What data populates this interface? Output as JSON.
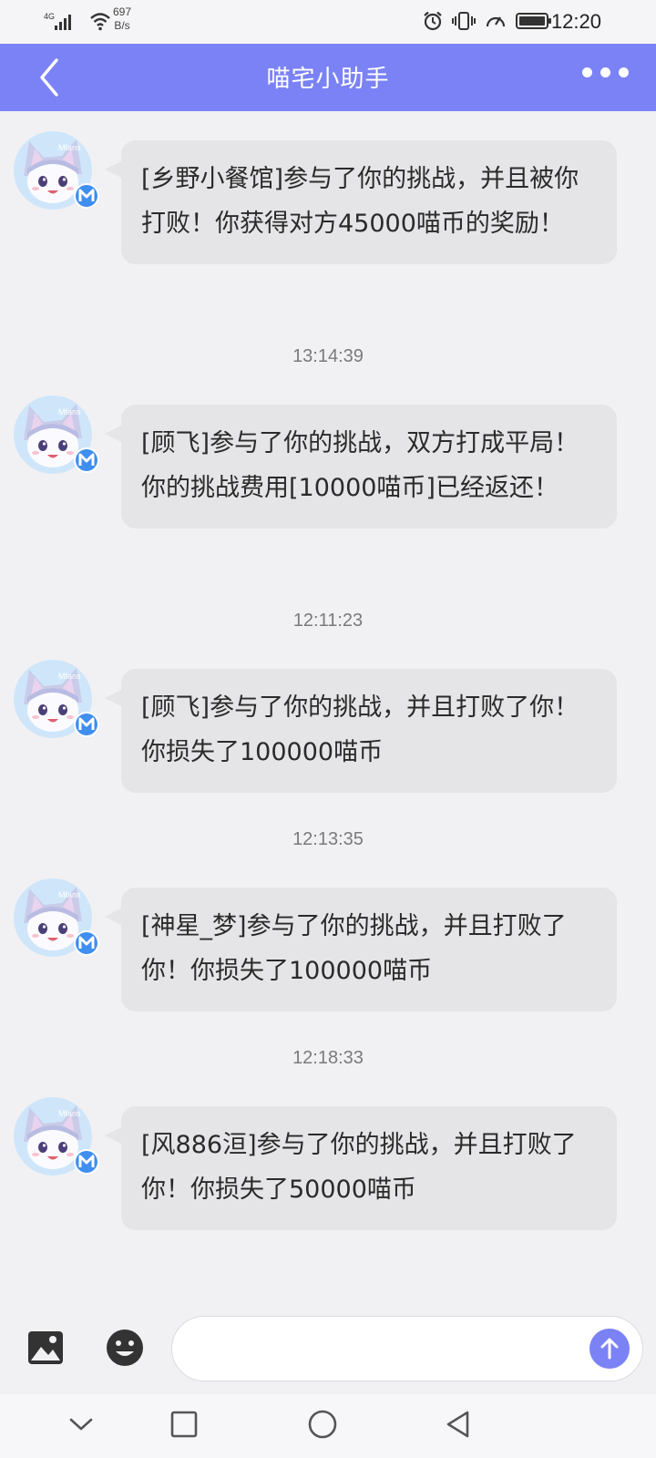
{
  "status_bar": {
    "network": "4G",
    "data_rate_value": "697",
    "data_rate_unit": "B/s",
    "time": "12:20"
  },
  "header": {
    "title": "喵宅小助手"
  },
  "avatar_label": "Mfans",
  "messages": [
    {
      "text": "[乡野小餐馆]参与了你的挑战，并且被你打败！你获得对方45000喵币的奖励！",
      "time": "13:14:39"
    },
    {
      "text": "[顾飞]参与了你的挑战，双方打成平局！你的挑战费用[10000喵币]已经返还！",
      "time": "12:11:23"
    },
    {
      "text": "[顾飞]参与了你的挑战，并且打败了你！你损失了100000喵币",
      "time": "12:13:35"
    },
    {
      "text": "[神星_梦]参与了你的挑战，并且打败了你！你损失了100000喵币",
      "time": "12:18:33"
    },
    {
      "text": "[风886洹]参与了你的挑战，并且打败了你！你损失了50000喵币"
    }
  ],
  "input": {
    "value": "",
    "placeholder": ""
  },
  "colors": {
    "accent": "#7b82f6",
    "bubble": "#e5e5e7",
    "background": "#f1f1f4"
  }
}
